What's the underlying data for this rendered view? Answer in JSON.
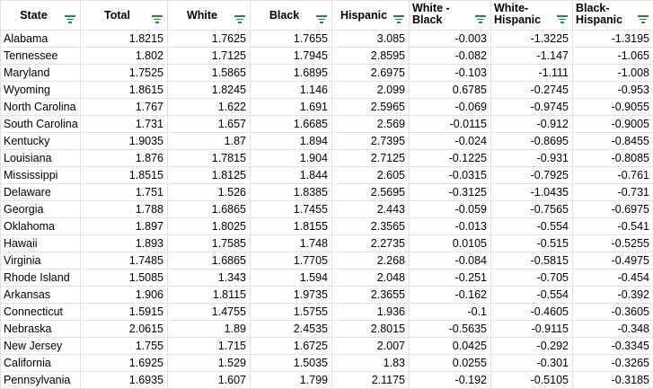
{
  "columns": [
    "State",
    "Total",
    "White",
    "Black",
    "Hispanic",
    "White - Black",
    "White- Hispanic",
    "Black- Hispanic"
  ],
  "filter_icon": "filter-icon",
  "accent_color": "#1e8e3e",
  "rows": [
    [
      "Alabama",
      "1.8215",
      "1.7625",
      "1.7655",
      "3.085",
      "-0.003",
      "-1.3225",
      "-1.3195"
    ],
    [
      "Tennessee",
      "1.802",
      "1.7125",
      "1.7945",
      "2.8595",
      "-0.082",
      "-1.147",
      "-1.065"
    ],
    [
      "Maryland",
      "1.7525",
      "1.5865",
      "1.6895",
      "2.6975",
      "-0.103",
      "-1.111",
      "-1.008"
    ],
    [
      "Wyoming",
      "1.8615",
      "1.8245",
      "1.146",
      "2.099",
      "0.6785",
      "-0.2745",
      "-0.953"
    ],
    [
      "North Carolina",
      "1.767",
      "1.622",
      "1.691",
      "2.5965",
      "-0.069",
      "-0.9745",
      "-0.9055"
    ],
    [
      "South Carolina",
      "1.731",
      "1.657",
      "1.6685",
      "2.569",
      "-0.0115",
      "-0.912",
      "-0.9005"
    ],
    [
      "Kentucky",
      "1.9035",
      "1.87",
      "1.894",
      "2.7395",
      "-0.024",
      "-0.8695",
      "-0.8455"
    ],
    [
      "Louisiana",
      "1.876",
      "1.7815",
      "1.904",
      "2.7125",
      "-0.1225",
      "-0.931",
      "-0.8085"
    ],
    [
      "Mississippi",
      "1.8515",
      "1.8125",
      "1.844",
      "2.605",
      "-0.0315",
      "-0.7925",
      "-0.761"
    ],
    [
      "Delaware",
      "1.751",
      "1.526",
      "1.8385",
      "2.5695",
      "-0.3125",
      "-1.0435",
      "-0.731"
    ],
    [
      "Georgia",
      "1.788",
      "1.6865",
      "1.7455",
      "2.443",
      "-0.059",
      "-0.7565",
      "-0.6975"
    ],
    [
      "Oklahoma",
      "1.897",
      "1.8025",
      "1.8155",
      "2.3565",
      "-0.013",
      "-0.554",
      "-0.541"
    ],
    [
      "Hawaii",
      "1.893",
      "1.7585",
      "1.748",
      "2.2735",
      "0.0105",
      "-0.515",
      "-0.5255"
    ],
    [
      "Virginia",
      "1.7485",
      "1.6865",
      "1.7705",
      "2.268",
      "-0.084",
      "-0.5815",
      "-0.4975"
    ],
    [
      "Rhode Island",
      "1.5085",
      "1.343",
      "1.594",
      "2.048",
      "-0.251",
      "-0.705",
      "-0.454"
    ],
    [
      "Arkansas",
      "1.906",
      "1.8115",
      "1.9735",
      "2.3655",
      "-0.162",
      "-0.554",
      "-0.392"
    ],
    [
      "Connecticut",
      "1.5915",
      "1.4755",
      "1.5755",
      "1.936",
      "-0.1",
      "-0.4605",
      "-0.3605"
    ],
    [
      "Nebraska",
      "2.0615",
      "1.89",
      "2.4535",
      "2.8015",
      "-0.5635",
      "-0.9115",
      "-0.348"
    ],
    [
      "New Jersey",
      "1.755",
      "1.715",
      "1.6725",
      "2.007",
      "0.0425",
      "-0.292",
      "-0.3345"
    ],
    [
      "California",
      "1.6925",
      "1.529",
      "1.5035",
      "1.83",
      "0.0255",
      "-0.301",
      "-0.3265"
    ],
    [
      "Pennsylvania",
      "1.6935",
      "1.607",
      "1.799",
      "2.1175",
      "-0.192",
      "-0.5105",
      "-0.3185"
    ]
  ]
}
